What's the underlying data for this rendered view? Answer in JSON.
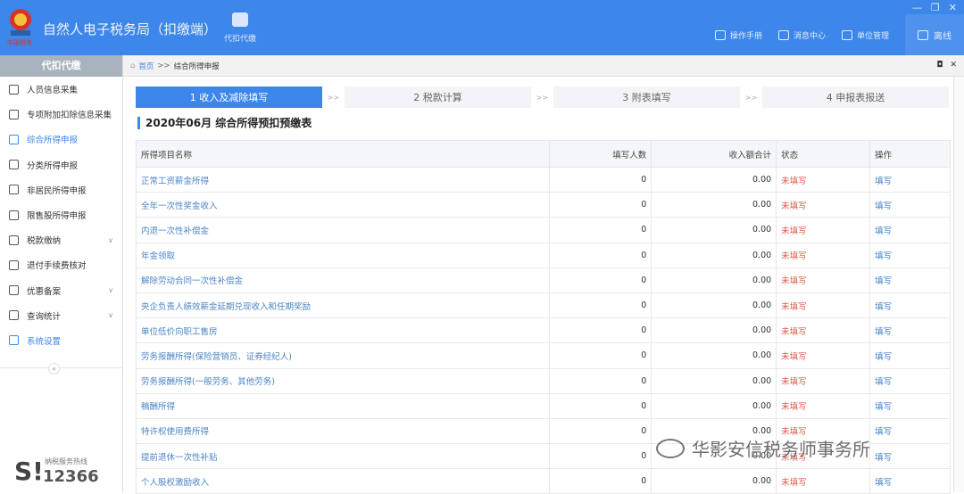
{
  "header": {
    "title": "自然人电子税务局（扣缴端）",
    "main_tool": "代扣代缴",
    "links": [
      {
        "label": "操作手册",
        "icon": "manual-icon"
      },
      {
        "label": "消息中心",
        "icon": "message-icon"
      },
      {
        "label": "单位管理",
        "icon": "building-icon"
      }
    ],
    "offline": "离线",
    "window_controls": [
      "—",
      "❐",
      "✕"
    ]
  },
  "sidebar": {
    "head": "代扣代缴",
    "items": [
      {
        "label": "人员信息采集",
        "icon": "person-icon"
      },
      {
        "label": "专项附加扣除信息采集",
        "icon": "list-icon"
      },
      {
        "label": "综合所得申报",
        "icon": "layers-icon",
        "active": true
      },
      {
        "label": "分类所得申报",
        "icon": "pie-icon"
      },
      {
        "label": "非居民所得申报",
        "icon": "user-icon"
      },
      {
        "label": "限售股所得申报",
        "icon": "bar-chart-icon"
      },
      {
        "label": "税款缴纳",
        "icon": "folder-icon",
        "expand": true
      },
      {
        "label": "退付手续费核对",
        "icon": "doc-check-icon"
      },
      {
        "label": "优惠备案",
        "icon": "file-icon",
        "expand": true
      },
      {
        "label": "查询统计",
        "icon": "search-list-icon",
        "expand": true
      },
      {
        "label": "系统设置",
        "icon": "gear-icon",
        "active_link": true
      }
    ],
    "collapse": "«",
    "hotline_label": "纳税服务热线",
    "hotline_number": "12366"
  },
  "breadcrumb": {
    "home": "首页",
    "sep": ">>",
    "current": "综合所得申报",
    "controls": [
      "◘",
      "✕"
    ]
  },
  "steps": [
    {
      "label": "1 收入及减除填写",
      "active": true
    },
    {
      "label": "2 税款计算"
    },
    {
      "label": "3 附表填写"
    },
    {
      "label": "4 申报表报送"
    }
  ],
  "step_sep": ">>",
  "form_title": "2020年06月  综合所得预扣预缴表",
  "table": {
    "headers": [
      "所得项目名称",
      "填写人数",
      "收入额合计",
      "状态",
      "操作"
    ],
    "rows": [
      [
        "正常工资薪金所得",
        "0",
        "0.00",
        "未填写",
        "填写"
      ],
      [
        "全年一次性奖金收入",
        "0",
        "0.00",
        "未填写",
        "填写"
      ],
      [
        "内退一次性补偿金",
        "0",
        "0.00",
        "未填写",
        "填写"
      ],
      [
        "年金领取",
        "0",
        "0.00",
        "未填写",
        "填写"
      ],
      [
        "解除劳动合同一次性补偿金",
        "0",
        "0.00",
        "未填写",
        "填写"
      ],
      [
        "央企负责人绩效薪金延期兑现收入和任期奖励",
        "0",
        "0.00",
        "未填写",
        "填写"
      ],
      [
        "单位低价向职工售房",
        "0",
        "0.00",
        "未填写",
        "填写"
      ],
      [
        "劳务报酬所得(保险营销员、证券经纪人)",
        "0",
        "0.00",
        "未填写",
        "填写"
      ],
      [
        "劳务报酬所得(一般劳务、其他劳务)",
        "0",
        "0.00",
        "未填写",
        "填写"
      ],
      [
        "稿酬所得",
        "0",
        "0.00",
        "未填写",
        "填写"
      ],
      [
        "特许权使用费所得",
        "0",
        "0.00",
        "未填写",
        "填写"
      ],
      [
        "提前退休一次性补贴",
        "0",
        "0.00",
        "未填写",
        "填写"
      ],
      [
        "个人股权激励收入",
        "0",
        "0.00",
        "未填写",
        "填写"
      ]
    ]
  },
  "watermark": "华影安信税务师事务所"
}
